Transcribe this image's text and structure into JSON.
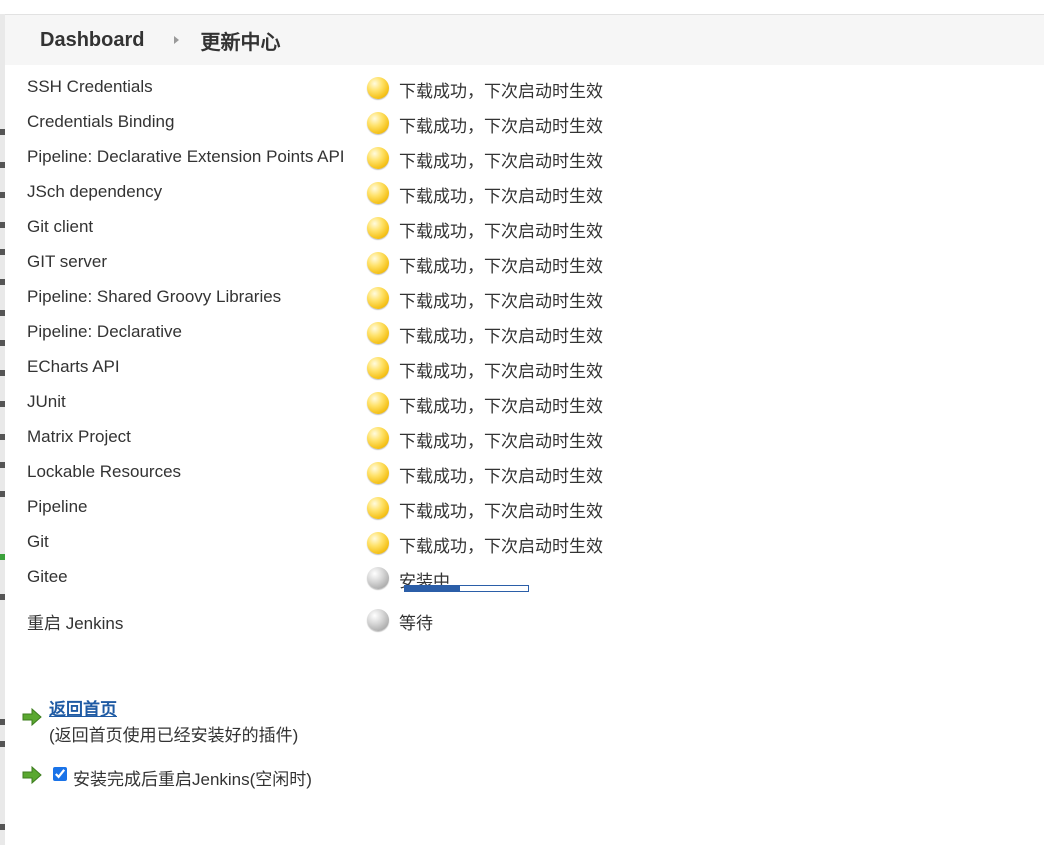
{
  "breadcrumb": {
    "home": "Dashboard",
    "current": "更新中心"
  },
  "plugins": [
    {
      "name": "SSH Credentials",
      "status": "下载成功，下次启动时生效",
      "state": "yellow"
    },
    {
      "name": "Credentials Binding",
      "status": "下载成功，下次启动时生效",
      "state": "yellow"
    },
    {
      "name": "Pipeline: Declarative Extension Points API",
      "status": "下载成功，下次启动时生效",
      "state": "yellow"
    },
    {
      "name": "JSch dependency",
      "status": "下载成功，下次启动时生效",
      "state": "yellow"
    },
    {
      "name": "Git client",
      "status": "下载成功，下次启动时生效",
      "state": "yellow"
    },
    {
      "name": "GIT server",
      "status": "下载成功，下次启动时生效",
      "state": "yellow"
    },
    {
      "name": "Pipeline: Shared Groovy Libraries",
      "status": "下载成功，下次启动时生效",
      "state": "yellow"
    },
    {
      "name": "Pipeline: Declarative",
      "status": "下载成功，下次启动时生效",
      "state": "yellow"
    },
    {
      "name": "ECharts API",
      "status": "下载成功，下次启动时生效",
      "state": "yellow"
    },
    {
      "name": "JUnit",
      "status": "下载成功，下次启动时生效",
      "state": "yellow"
    },
    {
      "name": "Matrix Project",
      "status": "下载成功，下次启动时生效",
      "state": "yellow"
    },
    {
      "name": "Lockable Resources",
      "status": "下载成功，下次启动时生效",
      "state": "yellow"
    },
    {
      "name": "Pipeline",
      "status": "下载成功，下次启动时生效",
      "state": "yellow"
    },
    {
      "name": "Git",
      "status": "下载成功，下次启动时生效",
      "state": "yellow"
    }
  ],
  "installing": {
    "name": "Gitee",
    "status": "安装中",
    "state": "grey",
    "progress": 0.45
  },
  "pending": {
    "name": "重启 Jenkins",
    "status": "等待",
    "state": "grey"
  },
  "actions": {
    "back_label": "返回首页",
    "back_sub": "(返回首页使用已经安装好的插件)",
    "restart_label": "安装完成后重启Jenkins(空闲时)",
    "restart_checked": true
  },
  "icons": {
    "status_success": "yellow-ball-icon",
    "status_pending": "grey-ball-icon",
    "action": "green-arrow-icon"
  },
  "colors": {
    "link": "#1f5ba4",
    "progress": "#2b5ea8",
    "arrow": "#5aa830"
  }
}
